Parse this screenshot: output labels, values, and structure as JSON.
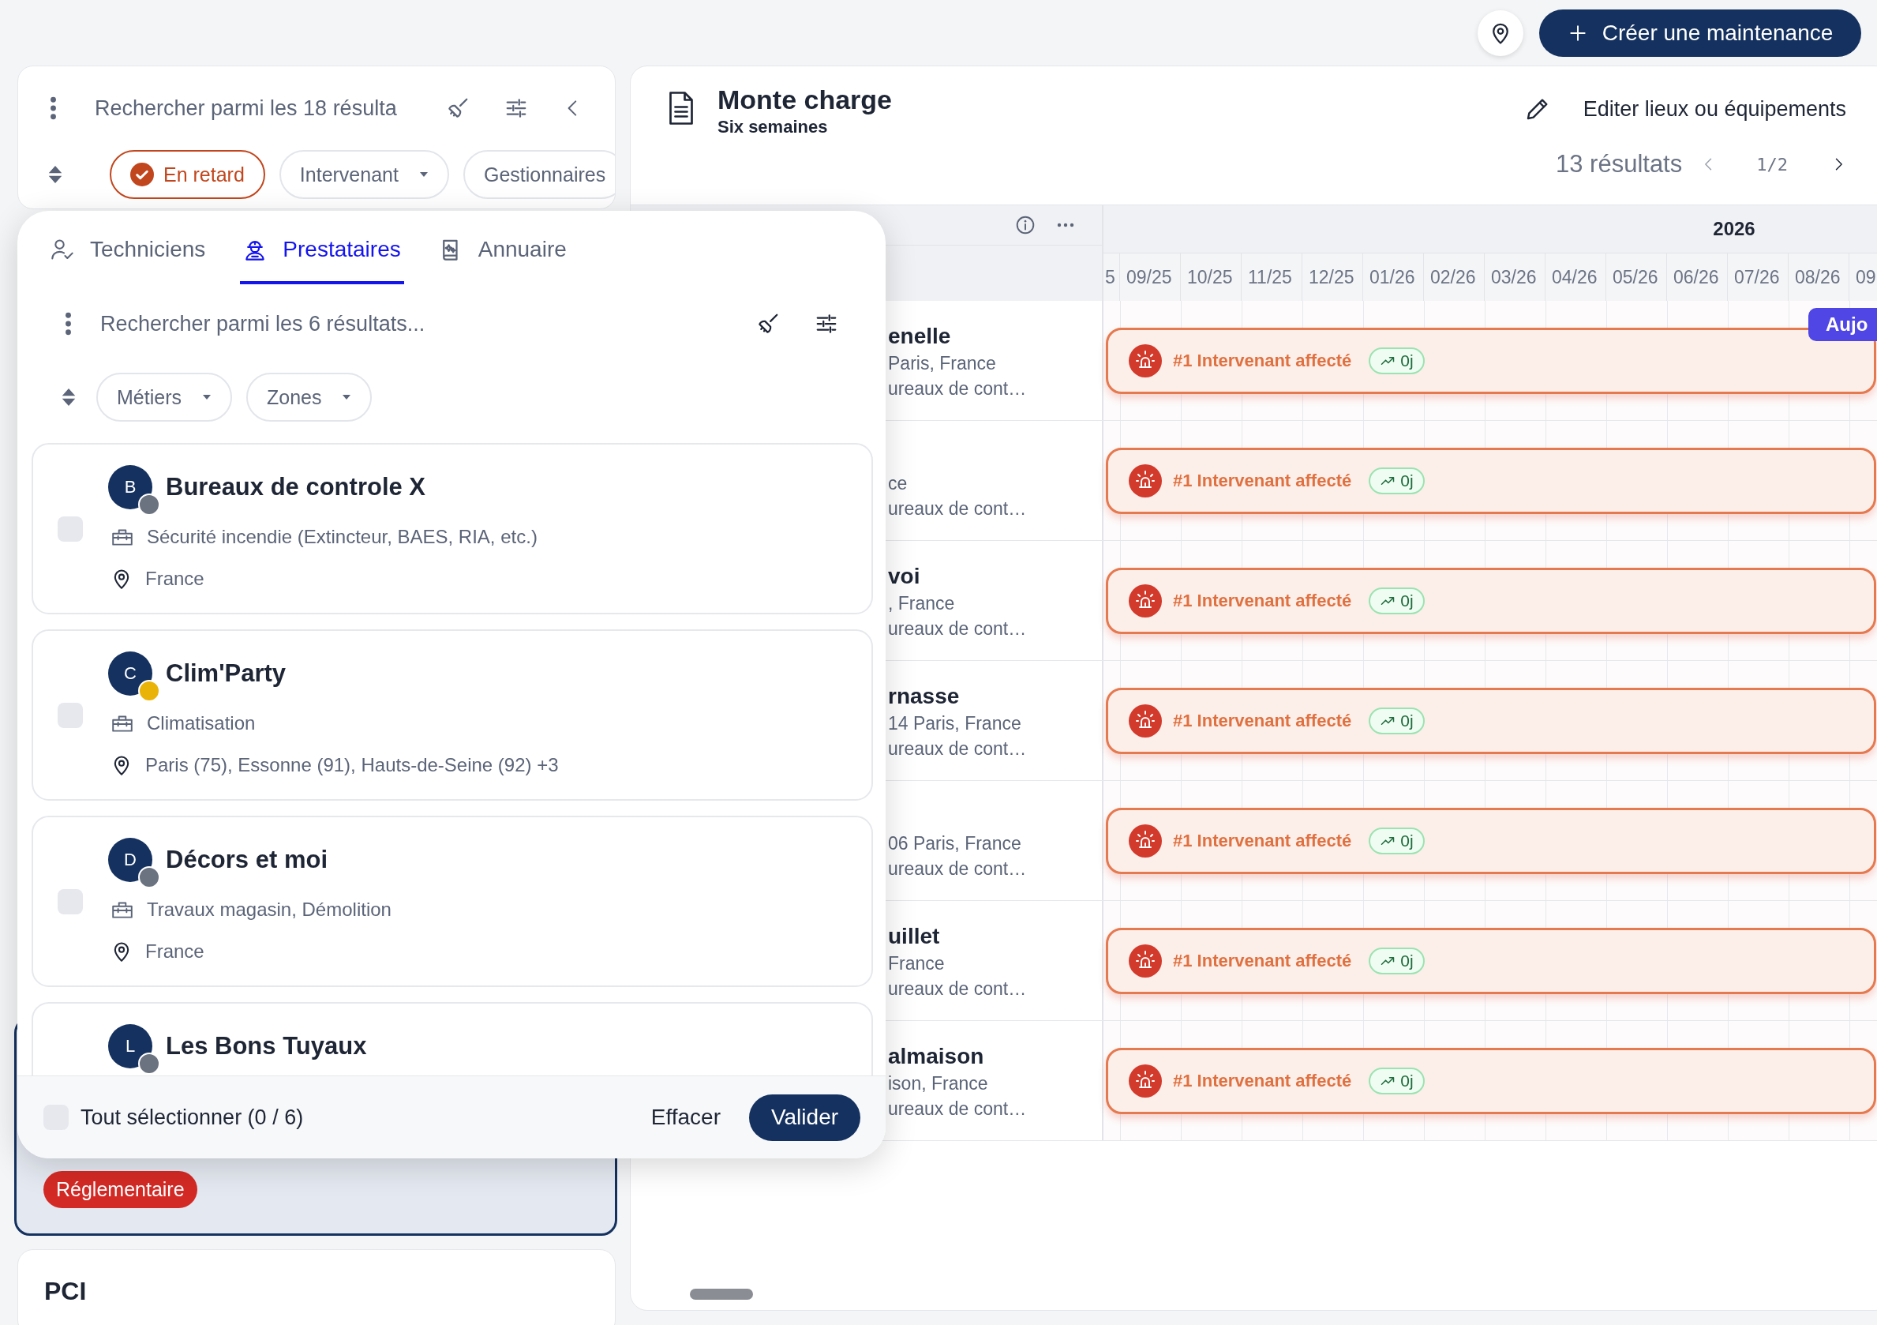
{
  "top_actions": {
    "create_button": "Créer une maintenance"
  },
  "left_panel": {
    "search": {
      "placeholder": "Rechercher parmi les 18 résulta"
    },
    "filters": [
      {
        "label": "En retard",
        "kind": "toggle",
        "selected": true
      },
      {
        "label": "Intervenant",
        "kind": "dropdown",
        "selected": false
      },
      {
        "label": "Gestionnaires",
        "kind": "toggle",
        "selected": false
      }
    ],
    "selected_card": {
      "tag": "Réglementaire"
    },
    "next_card": {
      "title": "PCI"
    }
  },
  "popover": {
    "tabs": [
      {
        "label": "Techniciens",
        "kind": "technicians",
        "selected": false
      },
      {
        "label": "Prestataires",
        "kind": "providers",
        "selected": true
      },
      {
        "label": "Annuaire",
        "kind": "directory",
        "selected": false
      }
    ],
    "search": {
      "placeholder": "Rechercher parmi les 6 résultats..."
    },
    "filters": [
      {
        "label": "Métiers"
      },
      {
        "label": "Zones"
      }
    ],
    "providers": [
      {
        "initial": "B",
        "name": "Bureaux de controle X",
        "color": "#6b7280",
        "checked": false,
        "trade": "Sécurité incendie (Extincteur, BAES, RIA, etc.)",
        "location": "France"
      },
      {
        "initial": "C",
        "name": "Clim'Party",
        "color": "#eab308",
        "checked": false,
        "trade": "Climatisation",
        "location": "Paris (75), Essonne (91), Hauts-de-Seine (92) +3"
      },
      {
        "initial": "D",
        "name": "Décors et moi",
        "color": "#6b7280",
        "checked": false,
        "trade": "Travaux magasin, Démolition",
        "location": "France"
      },
      {
        "initial": "L",
        "name": "Les Bons Tuyaux",
        "color": "#6b7280"
      }
    ],
    "select_all": {
      "label": "Tout sélectionner (0 / 6)",
      "checked": false
    },
    "clear_button": "Effacer",
    "submit_button": "Valider"
  },
  "main": {
    "title": "Monte charge",
    "subtitle": "Six semaines",
    "edit_button": "Editer lieux ou équipements",
    "result_count": "13 résultats",
    "page": "1/2"
  },
  "gantt": {
    "year": "2026",
    "months": [
      "5",
      "09/25",
      "10/25",
      "11/25",
      "12/25",
      "01/26",
      "02/26",
      "03/26",
      "04/26",
      "05/26",
      "06/26",
      "07/26",
      "08/26",
      "09"
    ],
    "today_badge": "Aujo",
    "rows": [
      {
        "name": "enelle",
        "address": "Paris, France",
        "detail": "ureaux de cont…",
        "bar": {
          "label": "#1 Intervenant affecté",
          "delay": "0j"
        }
      },
      {
        "address": "ce",
        "detail": "ureaux de cont…",
        "bar": {
          "label": "#1 Intervenant affecté",
          "delay": "0j"
        }
      },
      {
        "name": "voi",
        "address": ", France",
        "detail": "ureaux de cont…",
        "bar": {
          "label": "#1 Intervenant affecté",
          "delay": "0j"
        }
      },
      {
        "name": "rnasse",
        "address": "14 Paris, France",
        "detail": "ureaux de cont…",
        "bar": {
          "label": "#1 Intervenant affecté",
          "delay": "0j"
        }
      },
      {
        "address": "06 Paris, France",
        "detail": "ureaux de cont…",
        "bar": {
          "label": "#1 Intervenant affecté",
          "delay": "0j"
        }
      },
      {
        "name": "uillet",
        "address": "France",
        "detail": "ureaux de cont…",
        "bar": {
          "label": "#1 Intervenant affecté",
          "delay": "0j"
        }
      },
      {
        "name": "almaison",
        "address": "ison, France",
        "detail": "ureaux de cont…",
        "bar": {
          "label": "#1 Intervenant affecté",
          "delay": "0j"
        }
      }
    ]
  }
}
